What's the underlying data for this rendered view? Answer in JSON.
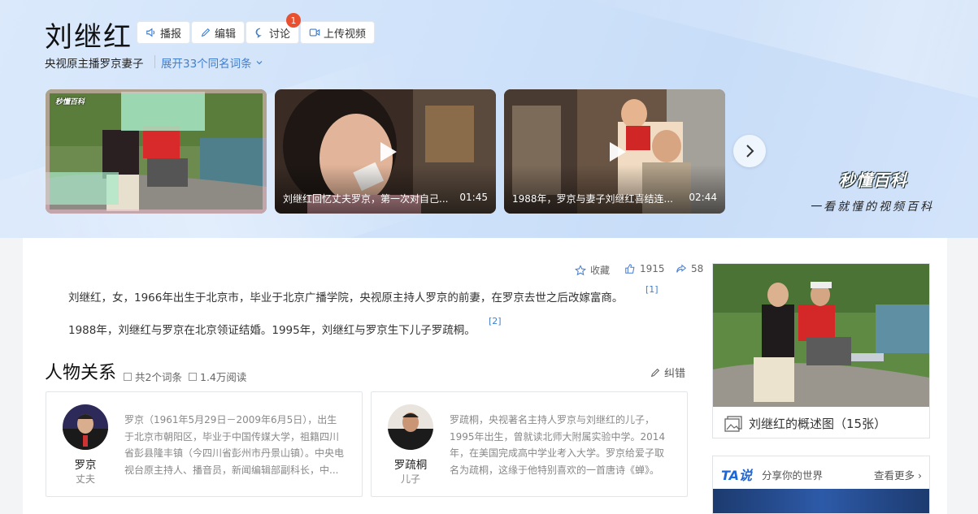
{
  "header": {
    "title": "刘继红",
    "actions": [
      {
        "label": "播报",
        "icon": "speaker-icon"
      },
      {
        "label": "编辑",
        "icon": "pencil-icon"
      },
      {
        "label": "讨论",
        "icon": "chat-bubble-icon",
        "badge": "1"
      },
      {
        "label": "上传视频",
        "icon": "video-upload-icon"
      }
    ],
    "subtitle": "央视原主播罗京妻子",
    "expand_label": "展开33个同名词条"
  },
  "videos": [
    {
      "caption": "",
      "duration": "",
      "watermark": "秒懂百科"
    },
    {
      "caption": "刘继红回忆丈夫罗京，第一次对自己...",
      "duration": "01:45"
    },
    {
      "caption": "1988年，罗京与妻子刘继红喜结连...",
      "duration": "02:44"
    }
  ],
  "brand": {
    "name": "秒懂百科",
    "tagline": "一看就懂的视频百科"
  },
  "stats": {
    "collect_label": "收藏",
    "likes": "1915",
    "shares": "58"
  },
  "summary": [
    {
      "text": "刘继红，女，1966年出生于北京市，毕业于北京广播学院，央视原主持人罗京的前妻，在罗京去世之后改嫁富商。",
      "ref": "[1]"
    },
    {
      "text": "1988年，刘继红与罗京在北京领证结婚。1995年，刘继红与罗京生下儿子罗疏桐。",
      "ref": "[2]"
    }
  ],
  "relations": {
    "title": "人物关系",
    "entry_count": "共2个词条",
    "views": "1.4万阅读",
    "correct_label": "纠错",
    "people": [
      {
        "name": "罗京",
        "role": "丈夫",
        "desc": "罗京（1961年5月29日－2009年6月5日），出生于北京市朝阳区，毕业于中国传媒大学，祖籍四川省彭县隆丰镇（今四川省彭州市丹景山镇）。中央电视台原主持人、播音员，新闻编辑部副科长，中..."
      },
      {
        "name": "罗疏桐",
        "role": "儿子",
        "desc": "罗疏桐，央视著名主持人罗京与刘继红的儿子，1995年出生，曾就读北师大附属实验中学。2014年，在美国完成高中学业考入大学。罗京给爱子取名为疏桐，这缘于他特别喜欢的一首唐诗《蝉》。"
      }
    ]
  },
  "side": {
    "album_label": "刘继红的概述图（15张）",
    "ta_logo": "TA说",
    "ta_tagline": "分享你的世界",
    "ta_more": "查看更多"
  }
}
